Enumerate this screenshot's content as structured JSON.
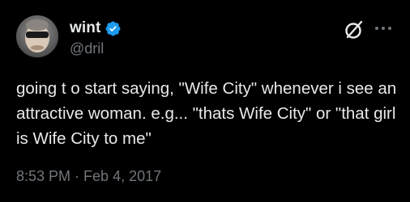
{
  "author": {
    "display_name": "wint",
    "handle": "@dril",
    "verified": true,
    "verified_color": "#1d9bf0"
  },
  "tweet": {
    "text": "going t o start saying, \"Wife City\" whenever i see an attractive woman. e.g... \"thats Wife City\" or \"that girl is Wife City to me\"",
    "time": "8:53 PM",
    "separator": "·",
    "date": "Feb 4, 2017"
  },
  "icons": {
    "avatar": "avatar-image",
    "verified": "verified-badge-icon",
    "grok": "grok-icon",
    "more": "more-options-icon"
  },
  "colors": {
    "background": "#000000",
    "text_primary": "#e7e9ea",
    "text_secondary": "#71767b"
  }
}
